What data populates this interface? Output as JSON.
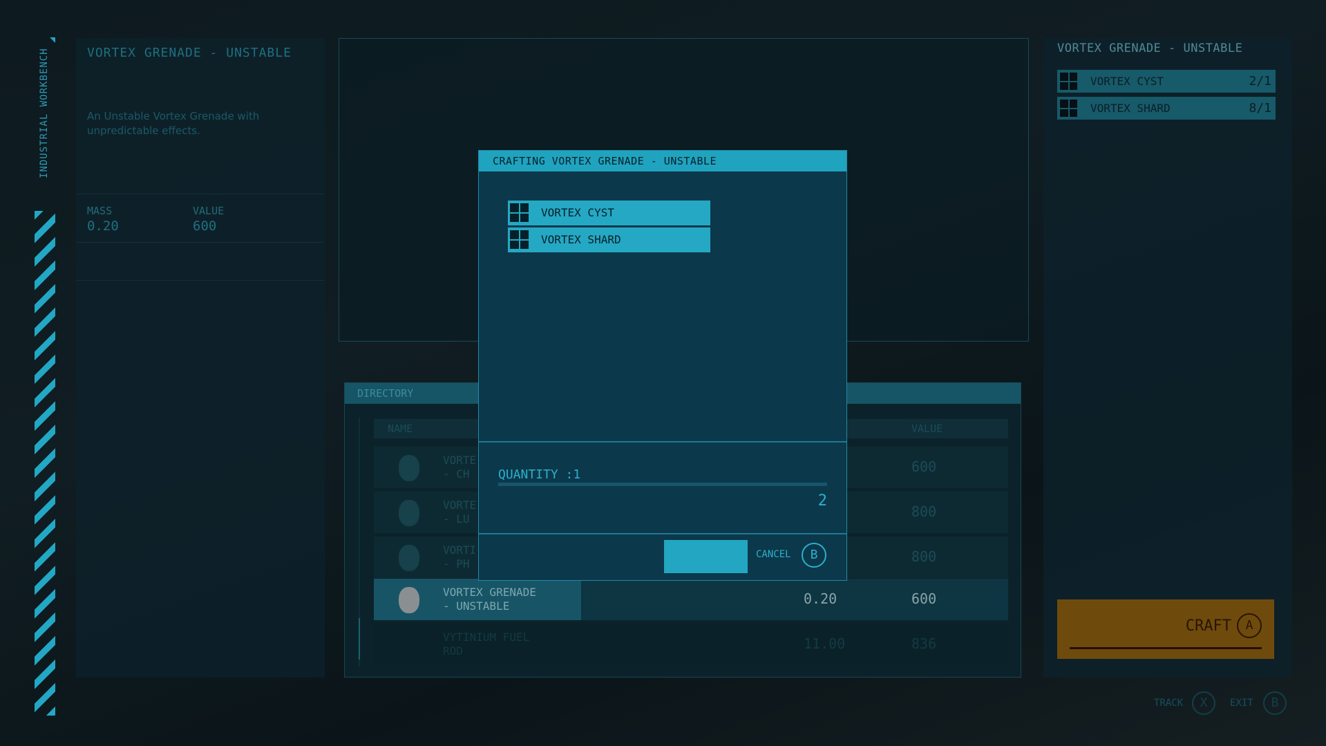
{
  "sidebar": {
    "title": "INDUSTRIAL WORKBENCH"
  },
  "item": {
    "title": "VORTEX GRENADE - UNSTABLE",
    "description": "An Unstable Vortex Grenade with unpredictable effects.",
    "mass_label": "MASS",
    "mass": "0.20",
    "value_label": "VALUE",
    "value": "600"
  },
  "directory": {
    "title": "DIRECTORY",
    "col_name": "NAME",
    "col_value": "VALUE",
    "rows": [
      {
        "name_1": "VORTE",
        "name_2": "- CH",
        "mass": "",
        "value": "600"
      },
      {
        "name_1": "VORTE",
        "name_2": "- LU",
        "mass": "",
        "value": "800"
      },
      {
        "name_1": "VORTI",
        "name_2": "- PH",
        "mass": "",
        "value": "800"
      },
      {
        "name_1": "VORTEX GRENADE",
        "name_2": "- UNSTABLE",
        "mass": "0.20",
        "value": "600",
        "selected": true
      },
      {
        "name_1": "VYTINIUM FUEL",
        "name_2": "ROD",
        "mass": "11.00",
        "value": "836"
      }
    ]
  },
  "requirements": {
    "title": "VORTEX GRENADE - UNSTABLE",
    "items": [
      {
        "name": "VORTEX CYST",
        "count": "2/1"
      },
      {
        "name": "VORTEX SHARD",
        "count": "8/1"
      }
    ]
  },
  "craft": {
    "label": "CRAFT",
    "key": "A",
    "color": "#6e4b0c"
  },
  "hints": {
    "track": "TRACK",
    "track_key": "X",
    "exit": "EXIT",
    "exit_key": "B"
  },
  "modal": {
    "title": "CRAFTING VORTEX GRENADE - UNSTABLE",
    "ingredients": [
      "VORTEX CYST",
      "VORTEX SHARD"
    ],
    "quantity_label": "QUANTITY :1",
    "quantity": 1,
    "quantity_max": "2",
    "cancel": "CANCEL",
    "cancel_key": "B"
  },
  "colors": {
    "accent": "#22a7c4",
    "modal_bg": "#0c384b"
  }
}
